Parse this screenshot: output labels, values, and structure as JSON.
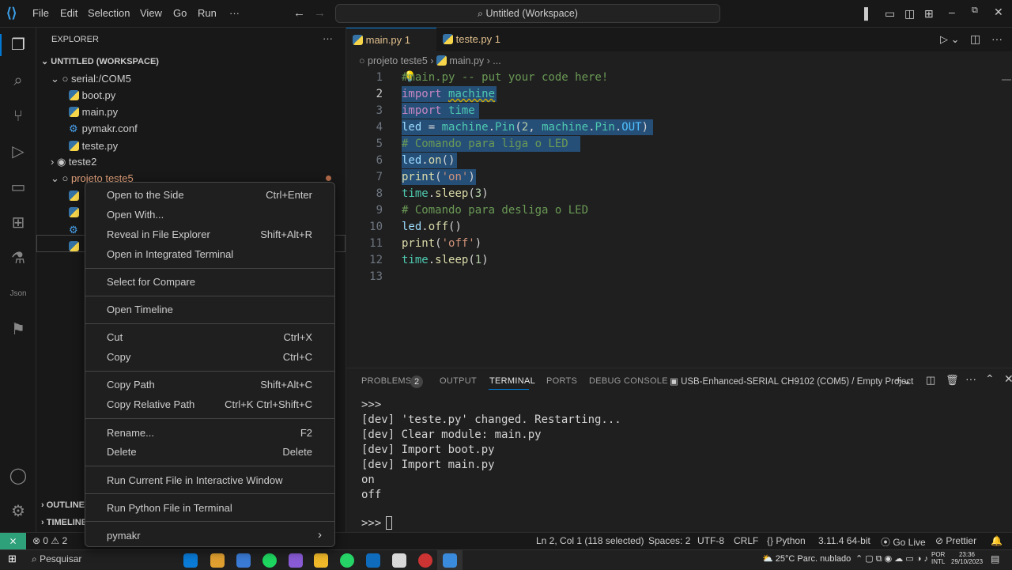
{
  "titlebar": {
    "menus": [
      "File",
      "Edit",
      "Selection",
      "View",
      "Go",
      "Run",
      "···"
    ],
    "search": "Untitled (Workspace)"
  },
  "sidebar": {
    "title": "EXPLORER",
    "more": "···",
    "workspace": "UNTITLED (WORKSPACE)",
    "serial": "serial:/COM5",
    "files": [
      "boot.py",
      "main.py",
      "pymakr.conf",
      "teste.py"
    ],
    "teste2": "teste2",
    "projeto": "projeto teste5",
    "outline": "OUTLINE",
    "timeline": "TIMELINE"
  },
  "tabs": [
    {
      "label": "main.py",
      "badge": "1"
    },
    {
      "label": "teste.py",
      "badge": "1"
    }
  ],
  "breadcrumb": {
    "folder": "projeto teste5",
    "file": "main.py",
    "rest": "..."
  },
  "editor": {
    "line_numbers": [
      "1",
      "2",
      "3",
      "4",
      "5",
      "6",
      "7",
      "8",
      "9",
      "10",
      "11",
      "12",
      "13"
    ]
  },
  "panel": {
    "problems": "PROBLEMS",
    "problems_count": "2",
    "output": "OUTPUT",
    "terminal": "TERMINAL",
    "ports": "PORTS",
    "debug": "DEBUG CONSOLE",
    "device": "USB-Enhanced-SERIAL CH9102 (COM5) / Empty Project",
    "lines": [
      ">>>",
      "[dev] 'teste.py' changed. Restarting...",
      "[dev] Clear module: main.py",
      "[dev] Import boot.py",
      "[dev] Import main.py",
      "on",
      "off"
    ],
    "prompt": ">>>"
  },
  "context_menu": {
    "items": [
      {
        "label": "Open to the Side",
        "key": "Ctrl+Enter"
      },
      {
        "label": "Open With...",
        "key": ""
      },
      {
        "label": "Reveal in File Explorer",
        "key": "Shift+Alt+R"
      },
      {
        "label": "Open in Integrated Terminal",
        "key": ""
      },
      {
        "label": "Select for Compare",
        "key": ""
      },
      {
        "label": "Open Timeline",
        "key": ""
      },
      {
        "label": "Cut",
        "key": "Ctrl+X"
      },
      {
        "label": "Copy",
        "key": "Ctrl+C"
      },
      {
        "label": "Copy Path",
        "key": "Shift+Alt+C"
      },
      {
        "label": "Copy Relative Path",
        "key": "Ctrl+K Ctrl+Shift+C"
      },
      {
        "label": "Rename...",
        "key": "F2"
      },
      {
        "label": "Delete",
        "key": "Delete"
      },
      {
        "label": "Run Current File in Interactive Window",
        "key": ""
      },
      {
        "label": "Run Python File in Terminal",
        "key": ""
      },
      {
        "label": "pymakr",
        "key": "›"
      }
    ]
  },
  "statusbar": {
    "errors": "0",
    "warnings": "2",
    "position": "Ln 2, Col 1 (118 selected)",
    "spaces": "Spaces: 2",
    "encoding": "UTF-8",
    "eol": "CRLF",
    "language": "Python",
    "version": "3.11.4 64-bit",
    "golive": "Go Live",
    "prettier": "Prettier"
  },
  "taskbar": {
    "search": "Pesquisar",
    "weather": "25°C",
    "weather_desc": "Parc. nublado",
    "lang1": "POR",
    "lang2": "INTL",
    "time": "23:36",
    "date": "29/10/2023"
  }
}
